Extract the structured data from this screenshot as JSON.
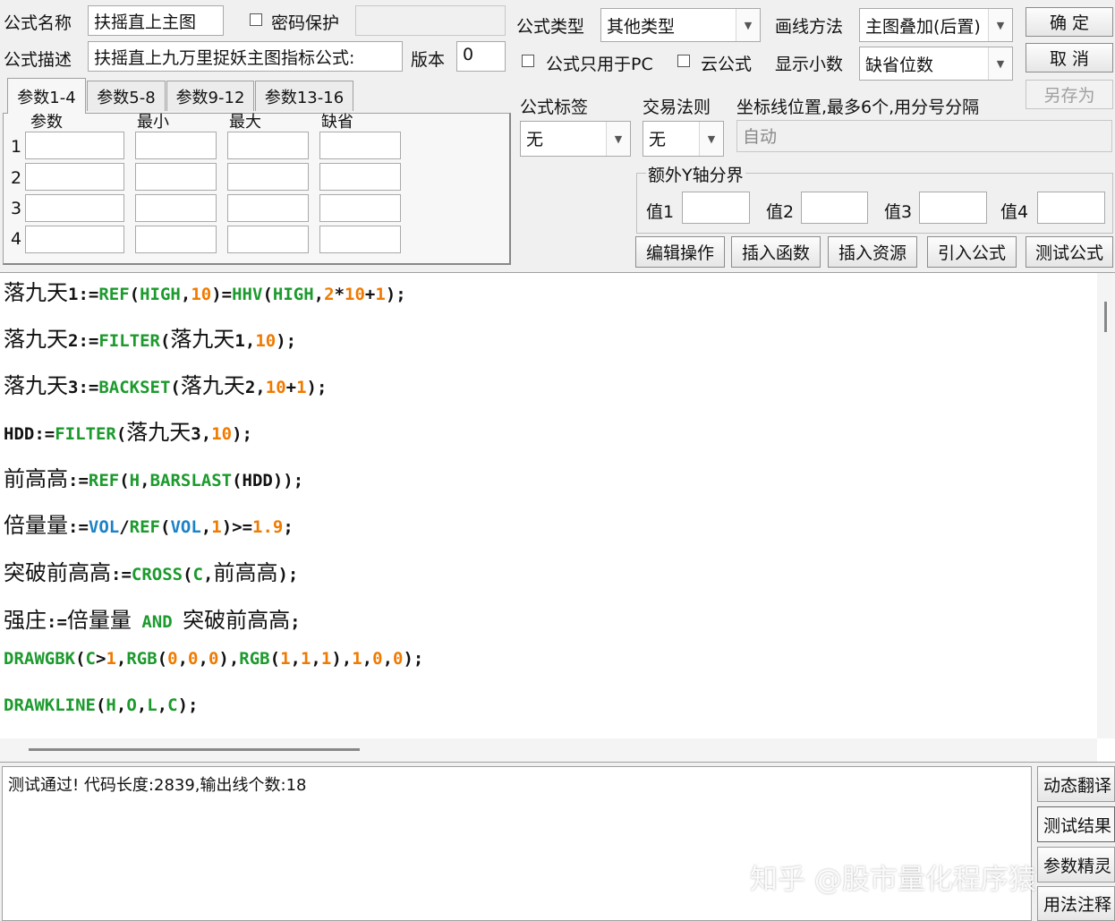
{
  "header": {
    "name_label": "公式名称",
    "name_value": "扶摇直上主图",
    "password_label": "密码保护",
    "desc_label": "公式描述",
    "desc_value": "扶摇直上九万里捉妖主图指标公式:",
    "version_label": "版本",
    "version_value": "0",
    "type_label": "公式类型",
    "type_value": "其他类型",
    "draw_label": "画线方法",
    "draw_value": "主图叠加(后置)",
    "pc_only_label": "公式只用于PC",
    "cloud_label": "云公式",
    "decimals_label": "显示小数",
    "decimals_value": "缺省位数"
  },
  "buttons": {
    "ok": "确  定",
    "cancel": "取  消",
    "save_as": "另存为"
  },
  "tabs": [
    "参数1-4",
    "参数5-8",
    "参数9-12",
    "参数13-16"
  ],
  "params": {
    "columns": [
      "参数",
      "最小",
      "最大",
      "缺省"
    ],
    "rows": [
      "1",
      "2",
      "3",
      "4"
    ]
  },
  "tags": {
    "tag_label": "公式标签",
    "tag_value": "无",
    "rule_label": "交易法则",
    "rule_value": "无",
    "coord_label": "坐标线位置,最多6个,用分号分隔",
    "coord_value": "自动"
  },
  "extra_y": {
    "title": "额外Y轴分界",
    "labels": [
      "值1",
      "值2",
      "值3",
      "值4"
    ]
  },
  "actions": [
    "编辑操作",
    "插入函数",
    "插入资源",
    "引入公式",
    "测试公式"
  ],
  "code_lines": [
    [
      [
        "落九天",
        "cn"
      ],
      [
        "1:=",
        "k"
      ],
      [
        "REF",
        "g"
      ],
      [
        "(",
        "k"
      ],
      [
        "HIGH",
        "g"
      ],
      [
        ",",
        "k"
      ],
      [
        "10",
        "o"
      ],
      [
        ")=",
        "k"
      ],
      [
        "HHV",
        "g"
      ],
      [
        "(",
        "k"
      ],
      [
        "HIGH",
        "g"
      ],
      [
        ",",
        "k"
      ],
      [
        "2",
        "o"
      ],
      [
        "*",
        "k"
      ],
      [
        "10",
        "o"
      ],
      [
        "+",
        "k"
      ],
      [
        "1",
        "o"
      ],
      [
        ");",
        "k"
      ]
    ],
    [
      [
        "落九天",
        "cn"
      ],
      [
        "2:=",
        "k"
      ],
      [
        "FILTER",
        "g"
      ],
      [
        "(",
        "k"
      ],
      [
        "落九天",
        "cn"
      ],
      [
        "1,",
        "k"
      ],
      [
        "10",
        "o"
      ],
      [
        ");",
        "k"
      ]
    ],
    [
      [
        "落九天",
        "cn"
      ],
      [
        "3:=",
        "k"
      ],
      [
        "BACKSET",
        "g"
      ],
      [
        "(",
        "k"
      ],
      [
        "落九天",
        "cn"
      ],
      [
        "2,",
        "k"
      ],
      [
        "10",
        "o"
      ],
      [
        "+",
        "k"
      ],
      [
        "1",
        "o"
      ],
      [
        ");",
        "k"
      ]
    ],
    [
      [
        "HDD:=",
        "k"
      ],
      [
        "FILTER",
        "g"
      ],
      [
        "(",
        "k"
      ],
      [
        "落九天",
        "cn"
      ],
      [
        "3,",
        "k"
      ],
      [
        "10",
        "o"
      ],
      [
        ");",
        "k"
      ]
    ],
    [
      [
        "前高高",
        "cn"
      ],
      [
        ":=",
        "k"
      ],
      [
        "REF",
        "g"
      ],
      [
        "(",
        "k"
      ],
      [
        "H",
        "g"
      ],
      [
        ",",
        "k"
      ],
      [
        "BARSLAST",
        "g"
      ],
      [
        "(HDD));",
        "k"
      ]
    ],
    [
      [
        "倍量量",
        "cn"
      ],
      [
        ":=",
        "k"
      ],
      [
        "VOL",
        "b"
      ],
      [
        "/",
        "k"
      ],
      [
        "REF",
        "g"
      ],
      [
        "(",
        "k"
      ],
      [
        "VOL",
        "b"
      ],
      [
        ",",
        "k"
      ],
      [
        "1",
        "o"
      ],
      [
        ")>=",
        "k"
      ],
      [
        "1.9",
        "o"
      ],
      [
        ";",
        "k"
      ]
    ],
    [
      [
        "突破前高高",
        "cn"
      ],
      [
        ":=",
        "k"
      ],
      [
        "CROSS",
        "g"
      ],
      [
        "(",
        "k"
      ],
      [
        "C",
        "g"
      ],
      [
        ",",
        "k"
      ],
      [
        "前高高",
        "cn"
      ],
      [
        ");",
        "k"
      ]
    ],
    [
      [
        "强庄",
        "cn"
      ],
      [
        ":=",
        "k"
      ],
      [
        "倍量量",
        "cn"
      ],
      [
        " AND ",
        "g"
      ],
      [
        "突破前高高",
        "cn"
      ],
      [
        ";",
        "k"
      ]
    ],
    [
      [
        "DRAWGBK",
        "g"
      ],
      [
        "(",
        "k"
      ],
      [
        "C",
        "g"
      ],
      [
        ">",
        "k"
      ],
      [
        "1",
        "o"
      ],
      [
        ",",
        "k"
      ],
      [
        "RGB",
        "g"
      ],
      [
        "(",
        "k"
      ],
      [
        "0",
        "o"
      ],
      [
        ",",
        "k"
      ],
      [
        "0",
        "o"
      ],
      [
        ",",
        "k"
      ],
      [
        "0",
        "o"
      ],
      [
        "),",
        "k"
      ],
      [
        "RGB",
        "g"
      ],
      [
        "(",
        "k"
      ],
      [
        "1",
        "o"
      ],
      [
        ",",
        "k"
      ],
      [
        "1",
        "o"
      ],
      [
        ",",
        "k"
      ],
      [
        "1",
        "o"
      ],
      [
        "),",
        "k"
      ],
      [
        "1",
        "o"
      ],
      [
        ",",
        "k"
      ],
      [
        "0",
        "o"
      ],
      [
        ",",
        "k"
      ],
      [
        "0",
        "o"
      ],
      [
        ");",
        "k"
      ]
    ],
    [
      [
        "DRAWKLINE",
        "g"
      ],
      [
        "(",
        "k"
      ],
      [
        "H",
        "g"
      ],
      [
        ",",
        "k"
      ],
      [
        "O",
        "g"
      ],
      [
        ",",
        "k"
      ],
      [
        "L",
        "g"
      ],
      [
        ",",
        "k"
      ],
      [
        "C",
        "g"
      ],
      [
        ");",
        "k"
      ]
    ]
  ],
  "output": {
    "message": "测试通过! 代码长度:2839,输出线个数:18"
  },
  "side_buttons": [
    "动态翻译",
    "测试结果",
    "参数精灵",
    "用法注释"
  ],
  "watermark": "知乎 @股市量化程序猿"
}
